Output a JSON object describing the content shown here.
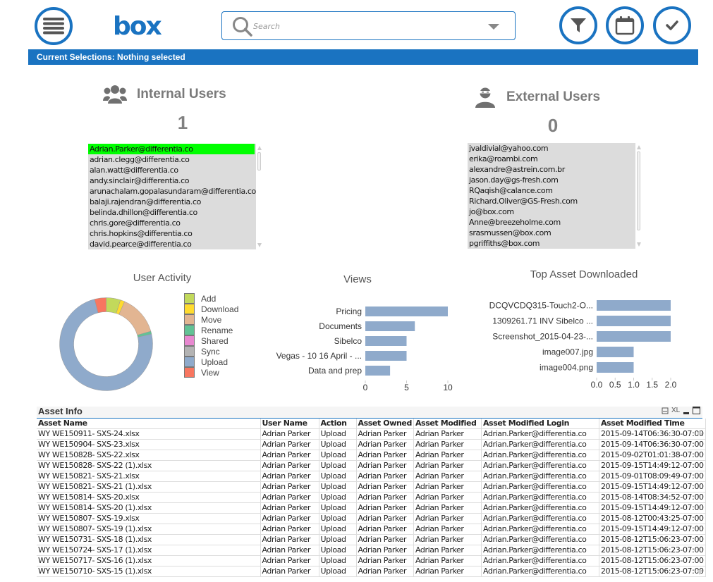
{
  "header": {
    "menu_icon": "hamburger-menu-icon",
    "logo_text": "box",
    "search": {
      "placeholder": "Search",
      "value": ""
    },
    "buttons": [
      {
        "name": "filter-button",
        "icon": "filter-icon"
      },
      {
        "name": "calendar-button",
        "icon": "calendar-icon"
      },
      {
        "name": "confirm-button",
        "icon": "checkmark-icon"
      }
    ]
  },
  "selection_bar": {
    "text": "Current Selections: Nothing selected"
  },
  "internal_users": {
    "title": "Internal Users",
    "icon": "user-group-icon",
    "count": "1",
    "items": [
      {
        "label": "Adrian.Parker@differentia.co",
        "selected": true
      },
      {
        "label": "adrian.clegg@differentia.co",
        "selected": false
      },
      {
        "label": "alan.watt@differentia.co",
        "selected": false
      },
      {
        "label": "andy.sinclair@differentia.co",
        "selected": false
      },
      {
        "label": "arunachalam.gopalasundaram@differentia.co",
        "selected": false
      },
      {
        "label": "balaji.rajendran@differentia.co",
        "selected": false
      },
      {
        "label": "belinda.dhillon@differentia.co",
        "selected": false
      },
      {
        "label": "chris.gore@differentia.co",
        "selected": false
      },
      {
        "label": "chris.hopkins@differentia.co",
        "selected": false
      },
      {
        "label": "david.pearce@differentia.co",
        "selected": false
      }
    ]
  },
  "external_users": {
    "title": "External Users",
    "icon": "masked-user-icon",
    "count": "0",
    "items": [
      {
        "label": "jvaldivial@yahoo.com",
        "selected": false
      },
      {
        "label": "erika@roambi.com",
        "selected": false
      },
      {
        "label": "alexandre@astrein.com.br",
        "selected": false
      },
      {
        "label": "jason.day@gs-fresh.com",
        "selected": false
      },
      {
        "label": "RQaqish@calance.com",
        "selected": false
      },
      {
        "label": "Richard.Oliver@GS-Fresh.com",
        "selected": false
      },
      {
        "label": "jo@box.com",
        "selected": false
      },
      {
        "label": "Anne@breezeholme.com",
        "selected": false
      },
      {
        "label": "srasmussen@box.com",
        "selected": false
      },
      {
        "label": "pgriffiths@box.com",
        "selected": false
      }
    ]
  },
  "chart_data": [
    {
      "type": "pie",
      "variant": "donut",
      "title": "User Activity",
      "legend_position": "right",
      "categories": [
        "Add",
        "Download",
        "Move",
        "Rename",
        "Shared",
        "Sync",
        "Upload",
        "View"
      ],
      "values": [
        5,
        1.5,
        14,
        1,
        0,
        0,
        74.5,
        4
      ],
      "unit": "percent (estimated)",
      "colors": [
        "#c2d95b",
        "#ffdb2e",
        "#e2b592",
        "#62c295",
        "#e888d0",
        "#b3b3b3",
        "#8faacb",
        "#f87660"
      ]
    },
    {
      "type": "bar",
      "orientation": "horizontal",
      "title": "Views",
      "categories": [
        "Pricing",
        "Documents",
        "Sibelco",
        "Vegas - 10 16 April - ...",
        "Data and prep"
      ],
      "values": [
        10,
        6,
        5,
        5,
        3
      ],
      "xlim": [
        0,
        10
      ],
      "xticks": [
        "0",
        "5",
        "10"
      ],
      "grid": false,
      "color": "#8faacb"
    },
    {
      "type": "bar",
      "orientation": "horizontal",
      "title": "Top Asset Downloaded",
      "categories": [
        "DCQVCDQ315-Touch2-O...",
        "1309261.71 INV Sibelco ...",
        "Screenshot_2015-04-23-...",
        "image007.jpg",
        "image004.png"
      ],
      "values": [
        2,
        2,
        2,
        1,
        1
      ],
      "xlim": [
        0,
        2
      ],
      "xticks": [
        "0.0",
        "0.5",
        "1.0",
        "1.5",
        "2.0"
      ],
      "grid": false,
      "color": "#8faacb"
    }
  ],
  "asset_info": {
    "title": "Asset Info",
    "tools": {
      "print": "print-icon",
      "excel": "XL",
      "minimize": "minimize-icon",
      "maximize": "maximize-icon"
    },
    "columns": [
      "Asset Name",
      "User Name",
      "Action",
      "Asset Owned",
      "Asset Modified",
      "Asset Modified Login",
      "Asset Modified Time"
    ],
    "rows": [
      [
        "WY WE150911- SXS-24.xlsx",
        "Adrian Parker",
        "Upload",
        "Adrian Parker",
        "Adrian Parker",
        "Adrian.Parker@differentia.co",
        "2015-09-14T06:36:30-07:00"
      ],
      [
        "WY WE150904- SXS-23.xlsx",
        "Adrian Parker",
        "Upload",
        "Adrian Parker",
        "Adrian Parker",
        "Adrian.Parker@differentia.co",
        "2015-09-14T06:36:30-07:00"
      ],
      [
        "WY WE150828- SXS-22.xlsx",
        "Adrian Parker",
        "Upload",
        "Adrian Parker",
        "Adrian Parker",
        "Adrian.Parker@differentia.co",
        "2015-09-02T01:01:38-07:00"
      ],
      [
        "WY WE150828- SXS-22 (1).xlsx",
        "Adrian Parker",
        "Upload",
        "Adrian Parker",
        "Adrian Parker",
        "Adrian.Parker@differentia.co",
        "2015-09-15T14:49:12-07:00"
      ],
      [
        "WY WE150821- SXS-21.xlsx",
        "Adrian Parker",
        "Upload",
        "Adrian Parker",
        "Adrian Parker",
        "Adrian.Parker@differentia.co",
        "2015-09-01T08:09:49-07:00"
      ],
      [
        "WY WE150821- SXS-21 (1).xlsx",
        "Adrian Parker",
        "Upload",
        "Adrian Parker",
        "Adrian Parker",
        "Adrian.Parker@differentia.co",
        "2015-09-15T14:49:12-07:00"
      ],
      [
        "WY WE150814- SXS-20.xlsx",
        "Adrian Parker",
        "Upload",
        "Adrian Parker",
        "Adrian Parker",
        "Adrian.Parker@differentia.co",
        "2015-08-14T08:34:52-07:00"
      ],
      [
        "WY WE150814- SXS-20 (1).xlsx",
        "Adrian Parker",
        "Upload",
        "Adrian Parker",
        "Adrian Parker",
        "Adrian.Parker@differentia.co",
        "2015-09-15T14:49:12-07:00"
      ],
      [
        "WY WE150807- SXS-19.xlsx",
        "Adrian Parker",
        "Upload",
        "Adrian Parker",
        "Adrian Parker",
        "Adrian.Parker@differentia.co",
        "2015-08-12T00:43:25-07:00"
      ],
      [
        "WY WE150807- SXS-19 (1).xlsx",
        "Adrian Parker",
        "Upload",
        "Adrian Parker",
        "Adrian Parker",
        "Adrian.Parker@differentia.co",
        "2015-09-15T14:49:12-07:00"
      ],
      [
        "WY WE150731- SXS-18 (1).xlsx",
        "Adrian Parker",
        "Upload",
        "Adrian Parker",
        "Adrian Parker",
        "Adrian.Parker@differentia.co",
        "2015-08-12T15:06:23-07:00"
      ],
      [
        "WY WE150724- SXS-17 (1).xlsx",
        "Adrian Parker",
        "Upload",
        "Adrian Parker",
        "Adrian Parker",
        "Adrian.Parker@differentia.co",
        "2015-08-12T15:06:23-07:00"
      ],
      [
        "WY WE150717- SXS-16 (1).xlsx",
        "Adrian Parker",
        "Upload",
        "Adrian Parker",
        "Adrian Parker",
        "Adrian.Parker@differentia.co",
        "2015-08-12T15:06:23-07:00"
      ],
      [
        "WY WE150710- SXS-15 (1).xlsx",
        "Adrian Parker",
        "Upload",
        "Adrian Parker",
        "Adrian Parker",
        "Adrian.Parker@differentia.co",
        "2015-08-12T15:06:23-07:00"
      ]
    ]
  },
  "colors": {
    "accent": "#1a73c1",
    "selected_item": "#00ff00",
    "listbox_bg": "#dcdcdc",
    "bar": "#8faacb"
  }
}
